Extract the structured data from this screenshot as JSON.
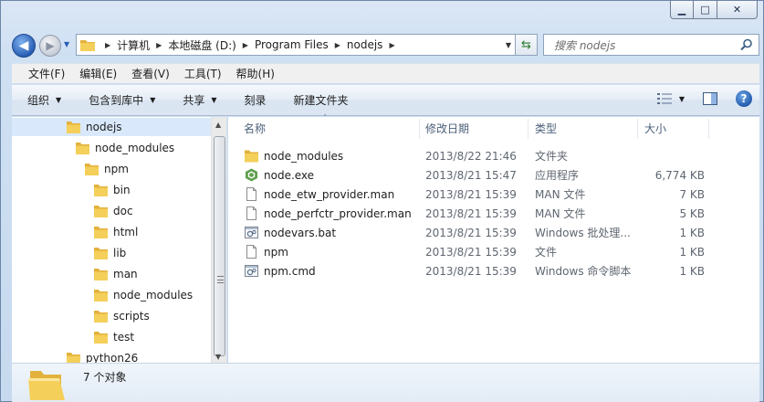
{
  "window": {
    "caption": {
      "minimize": "▁",
      "maximize": "□",
      "close": "✕"
    }
  },
  "nav": {
    "back_icon": "back-arrow-icon",
    "forward_icon": "forward-arrow-icon",
    "breadcrumbs": [
      "计算机",
      "本地磁盘 (D:)",
      "Program Files",
      "nodejs"
    ],
    "search_placeholder": "搜索 nodejs"
  },
  "menu": [
    "文件(F)",
    "编辑(E)",
    "查看(V)",
    "工具(T)",
    "帮助(H)"
  ],
  "commands": [
    {
      "label": "组织",
      "dropdown": true
    },
    {
      "label": "包含到库中",
      "dropdown": true
    },
    {
      "label": "共享",
      "dropdown": true
    },
    {
      "label": "刻录",
      "dropdown": false
    },
    {
      "label": "新建文件夹",
      "dropdown": false
    }
  ],
  "tree": [
    {
      "label": "nodejs",
      "level": 0,
      "selected": true
    },
    {
      "label": "node_modules",
      "level": 1
    },
    {
      "label": "npm",
      "level": 2
    },
    {
      "label": "bin",
      "level": 3
    },
    {
      "label": "doc",
      "level": 3
    },
    {
      "label": "html",
      "level": 3
    },
    {
      "label": "lib",
      "level": 3
    },
    {
      "label": "man",
      "level": 3
    },
    {
      "label": "node_modules",
      "level": 3
    },
    {
      "label": "scripts",
      "level": 3
    },
    {
      "label": "test",
      "level": 3
    },
    {
      "label": "python26",
      "level": 0
    }
  ],
  "columns": {
    "name": "名称",
    "date": "修改日期",
    "type": "类型",
    "size": "大小"
  },
  "files": [
    {
      "name": "node_modules",
      "date": "2013/8/22 21:46",
      "type": "文件夹",
      "size": "",
      "icon": "folder-icon"
    },
    {
      "name": "node.exe",
      "date": "2013/8/21 15:47",
      "type": "应用程序",
      "size": "6,774 KB",
      "icon": "node-exe-icon"
    },
    {
      "name": "node_etw_provider.man",
      "date": "2013/8/21 15:39",
      "type": "MAN 文件",
      "size": "7 KB",
      "icon": "file-icon"
    },
    {
      "name": "node_perfctr_provider.man",
      "date": "2013/8/21 15:39",
      "type": "MAN 文件",
      "size": "5 KB",
      "icon": "file-icon"
    },
    {
      "name": "nodevars.bat",
      "date": "2013/8/21 15:39",
      "type": "Windows 批处理...",
      "size": "1 KB",
      "icon": "batch-file-icon"
    },
    {
      "name": "npm",
      "date": "2013/8/21 15:39",
      "type": "文件",
      "size": "1 KB",
      "icon": "file-icon"
    },
    {
      "name": "npm.cmd",
      "date": "2013/8/21 15:39",
      "type": "Windows 命令脚本",
      "size": "1 KB",
      "icon": "batch-file-icon"
    }
  ],
  "status": {
    "count": "7 个对象"
  },
  "colors": {
    "folder": "#f4cf5a",
    "accent": "#2a5eb4",
    "selection": "#d9e9fb"
  }
}
